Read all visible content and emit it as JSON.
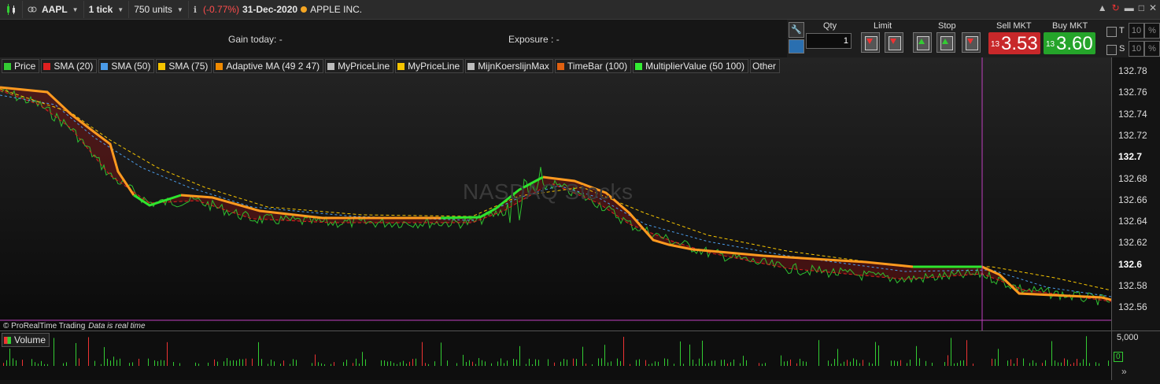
{
  "toolbar": {
    "symbol": "AAPL",
    "interval": "1 tick",
    "units": "750 units",
    "change": "(-0.77%)",
    "date": "31-Dec-2020",
    "company": "APPLE INC."
  },
  "info": {
    "gain_today": "Gain today:  -",
    "exposure": "Exposure :  -"
  },
  "order_panel": {
    "qty_label": "Qty",
    "qty_value": "1",
    "limit_label": "Limit",
    "stop_label": "Stop",
    "sell_label": "Sell MKT",
    "sell_small": "13",
    "sell_big": "3.53",
    "buy_label": "Buy MKT",
    "buy_small": "13",
    "buy_big": "3.60",
    "t_label": "T",
    "s_label": "S",
    "t_value": "10",
    "s_value": "10"
  },
  "legend": [
    {
      "label": "Price",
      "color": "#33cc33"
    },
    {
      "label": "SMA (20)",
      "color": "#e02020"
    },
    {
      "label": "SMA (50)",
      "color": "#4a9be8"
    },
    {
      "label": "SMA (75)",
      "color": "#f5c400"
    },
    {
      "label": "Adaptive MA (49 2 47)",
      "color": "#f08a00"
    },
    {
      "label": "MyPriceLine",
      "color": "#bdbdbd"
    },
    {
      "label": "MyPriceLine",
      "color": "#f5c400"
    },
    {
      "label": "MijnKoerslijnMax",
      "color": "#bdbdbd"
    },
    {
      "label": "TimeBar (100)",
      "color": "#e06010"
    },
    {
      "label": "MultiplierValue (50 100)",
      "color": "#33ee33"
    },
    {
      "label": "Other",
      "color": ""
    }
  ],
  "watermark": "NASDAQ Stocks",
  "price_axis": {
    "ticks": [
      "132.78",
      "132.76",
      "132.74",
      "132.72",
      "132.7",
      "132.68",
      "132.66",
      "132.64",
      "132.62",
      "132.6",
      "132.58",
      "132.56"
    ],
    "bold": [
      "132.7",
      "132.6"
    ]
  },
  "credits": {
    "brand": "© ProRealTime Trading",
    "status": "Data is real time"
  },
  "volume": {
    "label": "Volume",
    "axis_top": "5,000",
    "axis_bottom": "0"
  },
  "colors": {
    "price": "#2fbf2f",
    "sma20": "#e02020",
    "sma50": "#4a9be8",
    "sma75": "#f5c400",
    "adaptive_down": "#ff9a1f",
    "adaptive_up": "#2ee52e",
    "vline": "#c040c0"
  }
}
